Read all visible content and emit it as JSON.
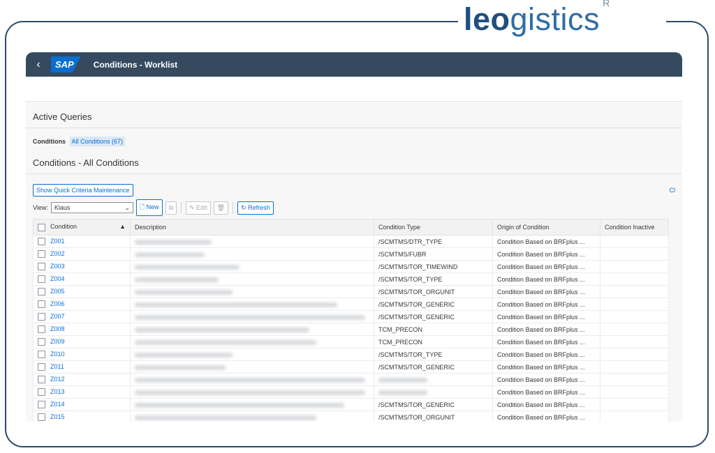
{
  "brand": {
    "logo_bold": "leo",
    "logo_rest": "gistics",
    "logo_mark": "R"
  },
  "shell": {
    "back": "‹",
    "sap": "SAP",
    "title": "Conditions - Worklist"
  },
  "active_queries": {
    "heading": "Active Queries",
    "label": "Conditions",
    "all_link": "All Conditions (67)"
  },
  "list": {
    "heading": "Conditions - All Conditions",
    "quick_criteria": "Show Quick Criteria Maintenance",
    "right_link": "Cl"
  },
  "toolbar": {
    "view_label": "View:",
    "view_value": "Klaus",
    "new": "New",
    "edit": "Edit",
    "refresh": "Refresh"
  },
  "table": {
    "columns": [
      "Condition",
      "Description",
      "Condition Type",
      "Origin of Condition",
      "Condition Inactive"
    ],
    "rows": [
      {
        "id": "Z001",
        "type": "/SCMTMS/DTR_TYPE",
        "origin": "Condition Based on BRFplus ..."
      },
      {
        "id": "Z002",
        "type": "/SCMTMS/FUBR",
        "origin": "Condition Based on BRFplus ..."
      },
      {
        "id": "Z003",
        "type": "/SCMTMS/TOR_TIMEWIND",
        "origin": "Condition Based on BRFplus ..."
      },
      {
        "id": "Z004",
        "type": "/SCMTMS/TOR_TYPE",
        "origin": "Condition Based on BRFplus ..."
      },
      {
        "id": "Z005",
        "type": "/SCMTMS/TOR_ORGUNIT",
        "origin": "Condition Based on BRFplus ..."
      },
      {
        "id": "Z006",
        "type": "/SCMTMS/TOR_GENERIC",
        "origin": "Condition Based on BRFplus ..."
      },
      {
        "id": "Z007",
        "type": "/SCMTMS/TOR_GENERIC",
        "origin": "Condition Based on BRFplus ..."
      },
      {
        "id": "Z008",
        "type": "TCM_PRECON",
        "origin": "Condition Based on BRFplus ..."
      },
      {
        "id": "Z009",
        "type": "TCM_PRECON",
        "origin": "Condition Based on BRFplus ..."
      },
      {
        "id": "Z010",
        "type": "/SCMTMS/TOR_TYPE",
        "origin": "Condition Based on BRFplus ..."
      },
      {
        "id": "Z011",
        "type": "/SCMTMS/TOR_GENERIC",
        "origin": "Condition Based on BRFplus ..."
      },
      {
        "id": "Z012",
        "type": "",
        "origin": "Condition Based on BRFplus ..."
      },
      {
        "id": "Z013",
        "type": "",
        "origin": "Condition Based on BRFplus ..."
      },
      {
        "id": "Z014",
        "type": "/SCMTMS/TOR_GENERIC",
        "origin": "Condition Based on BRFplus ..."
      },
      {
        "id": "Z015",
        "type": "/SCMTMS/TOR_ORGUNIT",
        "origin": "Condition Based on BRFplus ..."
      }
    ]
  },
  "colors": {
    "shell_bg": "#354a5f",
    "link": "#0a6ed1",
    "frame": "#2c4a6a"
  }
}
